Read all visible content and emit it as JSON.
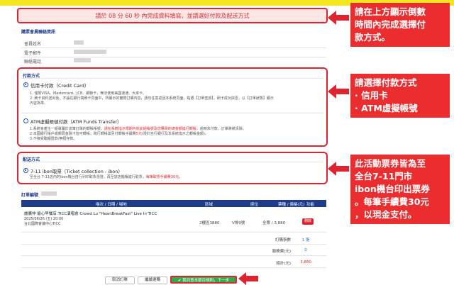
{
  "timer": {
    "text": "請於 08 分 60 秒 內完成資料填寫，並請選好付款及配送方式"
  },
  "member": {
    "title": "購票會員聯絡資訊",
    "rows": [
      {
        "label": "會員姓名"
      },
      {
        "label": "電子郵件"
      },
      {
        "label": "聯絡電話"
      }
    ]
  },
  "payment": {
    "title": "付款方式",
    "credit_label": "信用卡付款（Credit Card）",
    "credit_notes": [
      "1. 僅限VISA、Mastercard、JCB、銀聯卡，無法使用美國運通、大來卡。",
      "2. 刷卡資料送出後，不論在銀行端刷卡頁面中，所顯示的實際訂購內容，請勿任意返回本系統頁面，點選【訂單查詢】，刷卡成功與否，以【訂單狀態】顯示",
      "內容為準。"
    ],
    "atm_label": "ATM虛擬帳號付款（ATM Funds Transfer）",
    "atm_note1_a": "1.系統會產生一組專屬於該筆訂單的轉帳帳號，",
    "atm_note1_red": "請在系統指示限期內依此組帳號及您購買的總金額進行轉帳，",
    "atm_note1_b": "逾時未付款，訂單將被清除。",
    "atm_note2_a": "2.本國銀行帳戶或郵局金融卡皆可轉帳；跨行轉帳需另付轉帳手續費",
    "atm_note2_red": "5元",
    "atm_note2_b": "(限於自行銀行及本系統指示之轉帳金額)。",
    "atm_note3": "3.不接受臨櫃匯款/無摺存款。"
  },
  "delivery": {
    "title": "配送方式",
    "option_label": "7-11 ibon取票（Ticket collection - ibon）",
    "note_a": "至全台 7-11店內的ibon機台自行列印取票憑證，再至該店櫃檯進行取票，",
    "note_red": "每筆取票手續費30元。"
  },
  "order": {
    "title": "訂單編號",
    "headers": [
      "場次 / 日期 / 場地",
      "區域",
      "座位",
      "票種 / 價格(元)",
      "功能"
    ],
    "row": {
      "event": "盧廣仲 偷心早餐店 TICC演唱會 Crowd Lu \"HeartBreakFast\" Live In TICC",
      "date": "2025/08/26 (五) 20:00",
      "venue": "台北國際會議中心TICC",
      "area": "2樓區3880",
      "seat": "V排9號",
      "ticket": "全票 / 3,880",
      "delete": "刪除"
    },
    "summary": [
      {
        "label": "訂購張數",
        "value": "1 張",
        "color": "#2a6fd6"
      },
      {
        "label": "服務費(元)",
        "value": "0",
        "color": "#2a6fd6"
      },
      {
        "label": "總計(元)",
        "value": "3,880",
        "color": "#e0242f"
      }
    ]
  },
  "buttons": {
    "cancel": "取消訂單",
    "continue": "繼續選購",
    "agree": "✔ 我同意本節目規則，下一步"
  },
  "callouts": {
    "c1": [
      "請在上方顯示倒數",
      "時間內完成選擇付",
      "款方式。"
    ],
    "c2": [
      "請選擇付款方式",
      "· 信用卡",
      "· ATM虛擬帳號"
    ],
    "c3": [
      "此活動票券皆為至",
      "全台7-11門市",
      "ibon機台印出票券",
      "。每筆手續費30元",
      "，以現金支付。"
    ]
  },
  "colors": {
    "accent_red": "#e0242f",
    "navy": "#1f3c88",
    "green": "#2eae4a",
    "topbar": "#f5e71f"
  }
}
